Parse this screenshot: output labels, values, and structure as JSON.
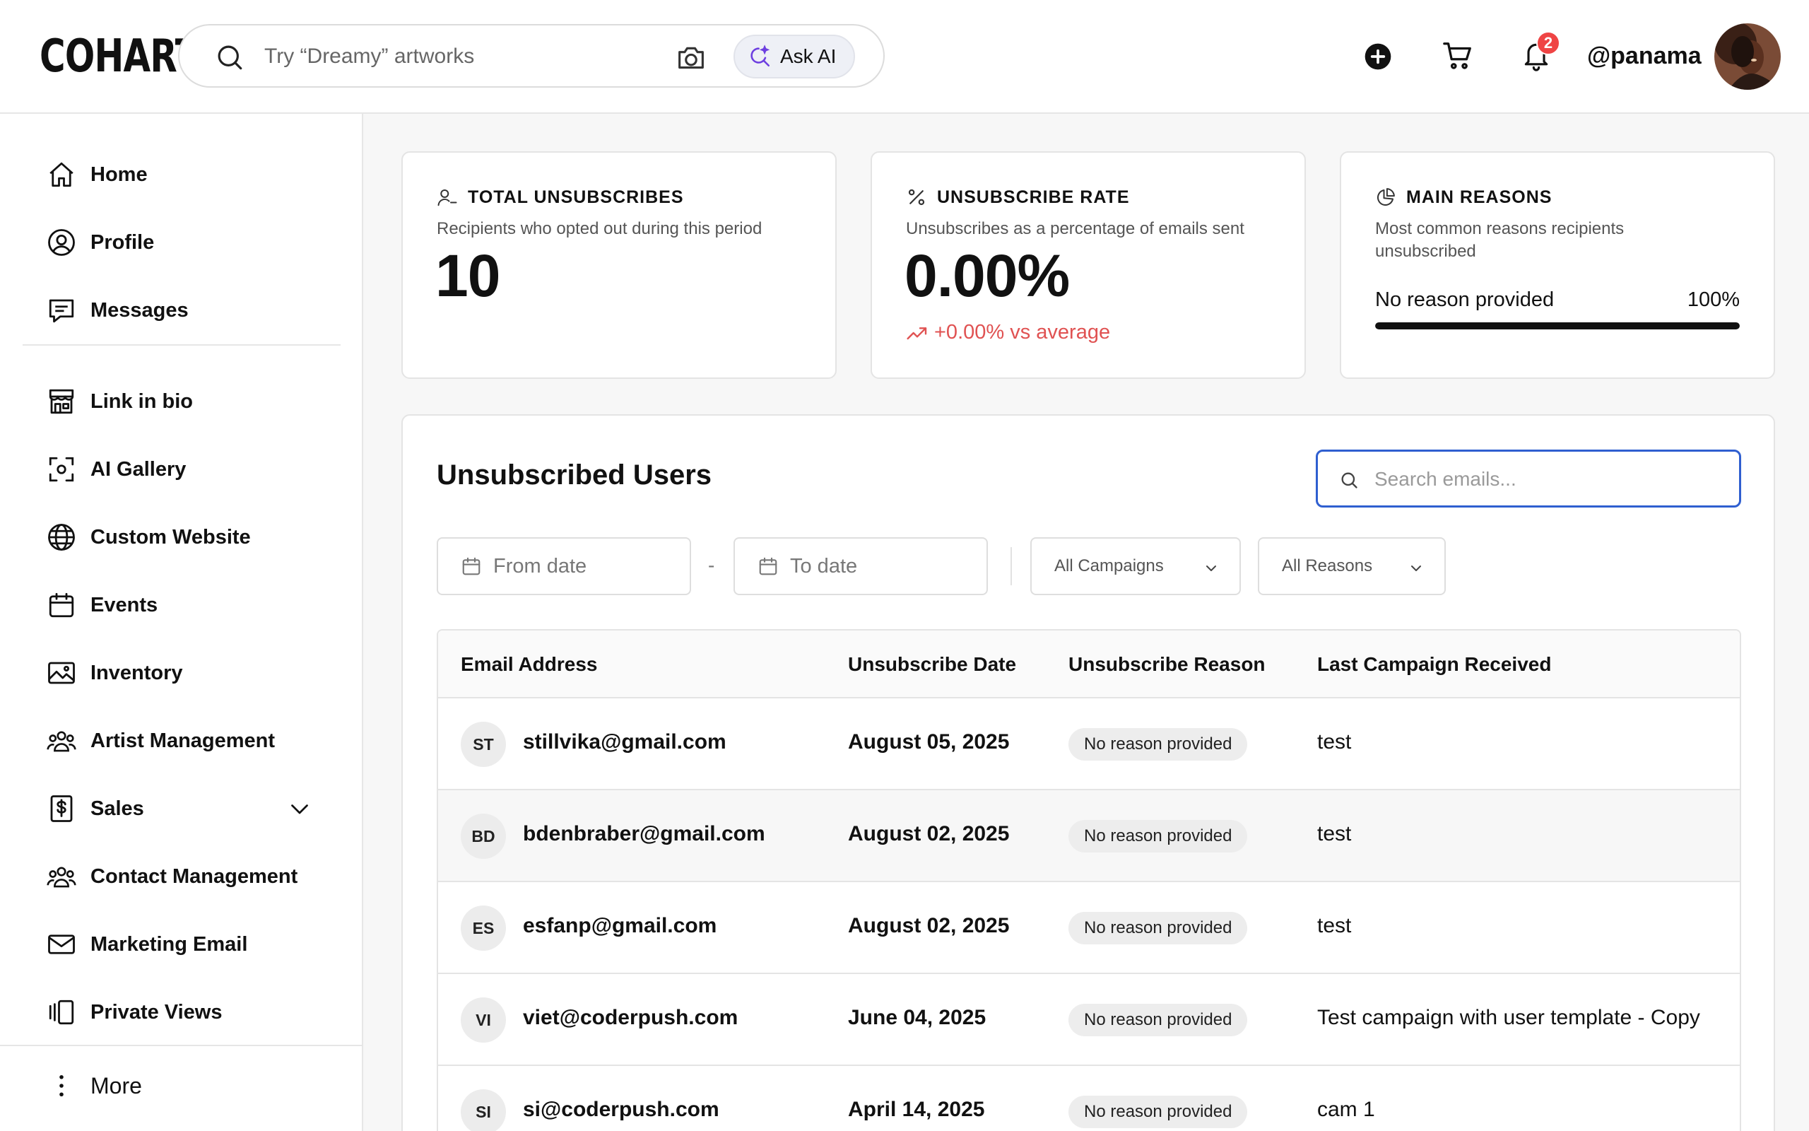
{
  "header": {
    "logo": "COHART",
    "search_placeholder": "Try “Dreamy” artworks",
    "ask_ai_label": "Ask AI",
    "notification_count": "2",
    "username": "@panama"
  },
  "sidebar": {
    "items": [
      {
        "label": "Home",
        "icon": "home-icon"
      },
      {
        "label": "Profile",
        "icon": "user-circle-icon"
      },
      {
        "label": "Messages",
        "icon": "chat-icon"
      },
      {
        "label": "Link in bio",
        "icon": "storefront-icon"
      },
      {
        "label": "AI Gallery",
        "icon": "scan-icon"
      },
      {
        "label": "Custom Website",
        "icon": "globe-icon"
      },
      {
        "label": "Events",
        "icon": "calendar-icon"
      },
      {
        "label": "Inventory",
        "icon": "image-icon"
      },
      {
        "label": "Artist Management",
        "icon": "users-icon"
      },
      {
        "label": "Sales",
        "icon": "dollar-doc-icon"
      },
      {
        "label": "Contact Management",
        "icon": "users-icon"
      },
      {
        "label": "Marketing Email",
        "icon": "mail-icon"
      },
      {
        "label": "Private Views",
        "icon": "cards-icon"
      }
    ],
    "more_label": "More"
  },
  "stats": {
    "total": {
      "title": "TOTAL UNSUBSCRIBES",
      "subtitle": "Recipients who opted out during this period",
      "value": "10"
    },
    "rate": {
      "title": "UNSUBSCRIBE RATE",
      "subtitle": "Unsubscribes as a percentage of emails sent",
      "value": "0.00%",
      "delta": "+0.00% vs average"
    },
    "reasons": {
      "title": "MAIN REASONS",
      "subtitle": "Most common reasons recipients unsubscribed",
      "top_reason": "No reason provided",
      "top_reason_pct": "100%",
      "top_reason_fraction": 1.0
    }
  },
  "panel": {
    "title": "Unsubscribed Users",
    "search_placeholder": "Search emails...",
    "from_date": "From date",
    "date_separator": "-",
    "to_date": "To date",
    "campaign_filter": "All Campaigns",
    "reason_filter": "All Reasons"
  },
  "table": {
    "columns": [
      "Email Address",
      "Unsubscribe Date",
      "Unsubscribe Reason",
      "Last Campaign Received"
    ],
    "rows": [
      {
        "initials": "ST",
        "email": "stillvika@gmail.com",
        "date": "August 05, 2025",
        "reason": "No reason provided",
        "campaign": "test"
      },
      {
        "initials": "BD",
        "email": "bdenbraber@gmail.com",
        "date": "August 02, 2025",
        "reason": "No reason provided",
        "campaign": "test"
      },
      {
        "initials": "ES",
        "email": "esfanp@gmail.com",
        "date": "August 02, 2025",
        "reason": "No reason provided",
        "campaign": "test"
      },
      {
        "initials": "VI",
        "email": "viet@coderpush.com",
        "date": "June 04, 2025",
        "reason": "No reason provided",
        "campaign": "Test campaign with user template - Copy"
      },
      {
        "initials": "SI",
        "email": "si@coderpush.com",
        "date": "April 14, 2025",
        "reason": "No reason provided",
        "campaign": "cam 1"
      }
    ]
  },
  "colors": {
    "accent_blue": "#2f5fd0",
    "delta_red": "#e05252",
    "badge_red": "#ef4444"
  }
}
